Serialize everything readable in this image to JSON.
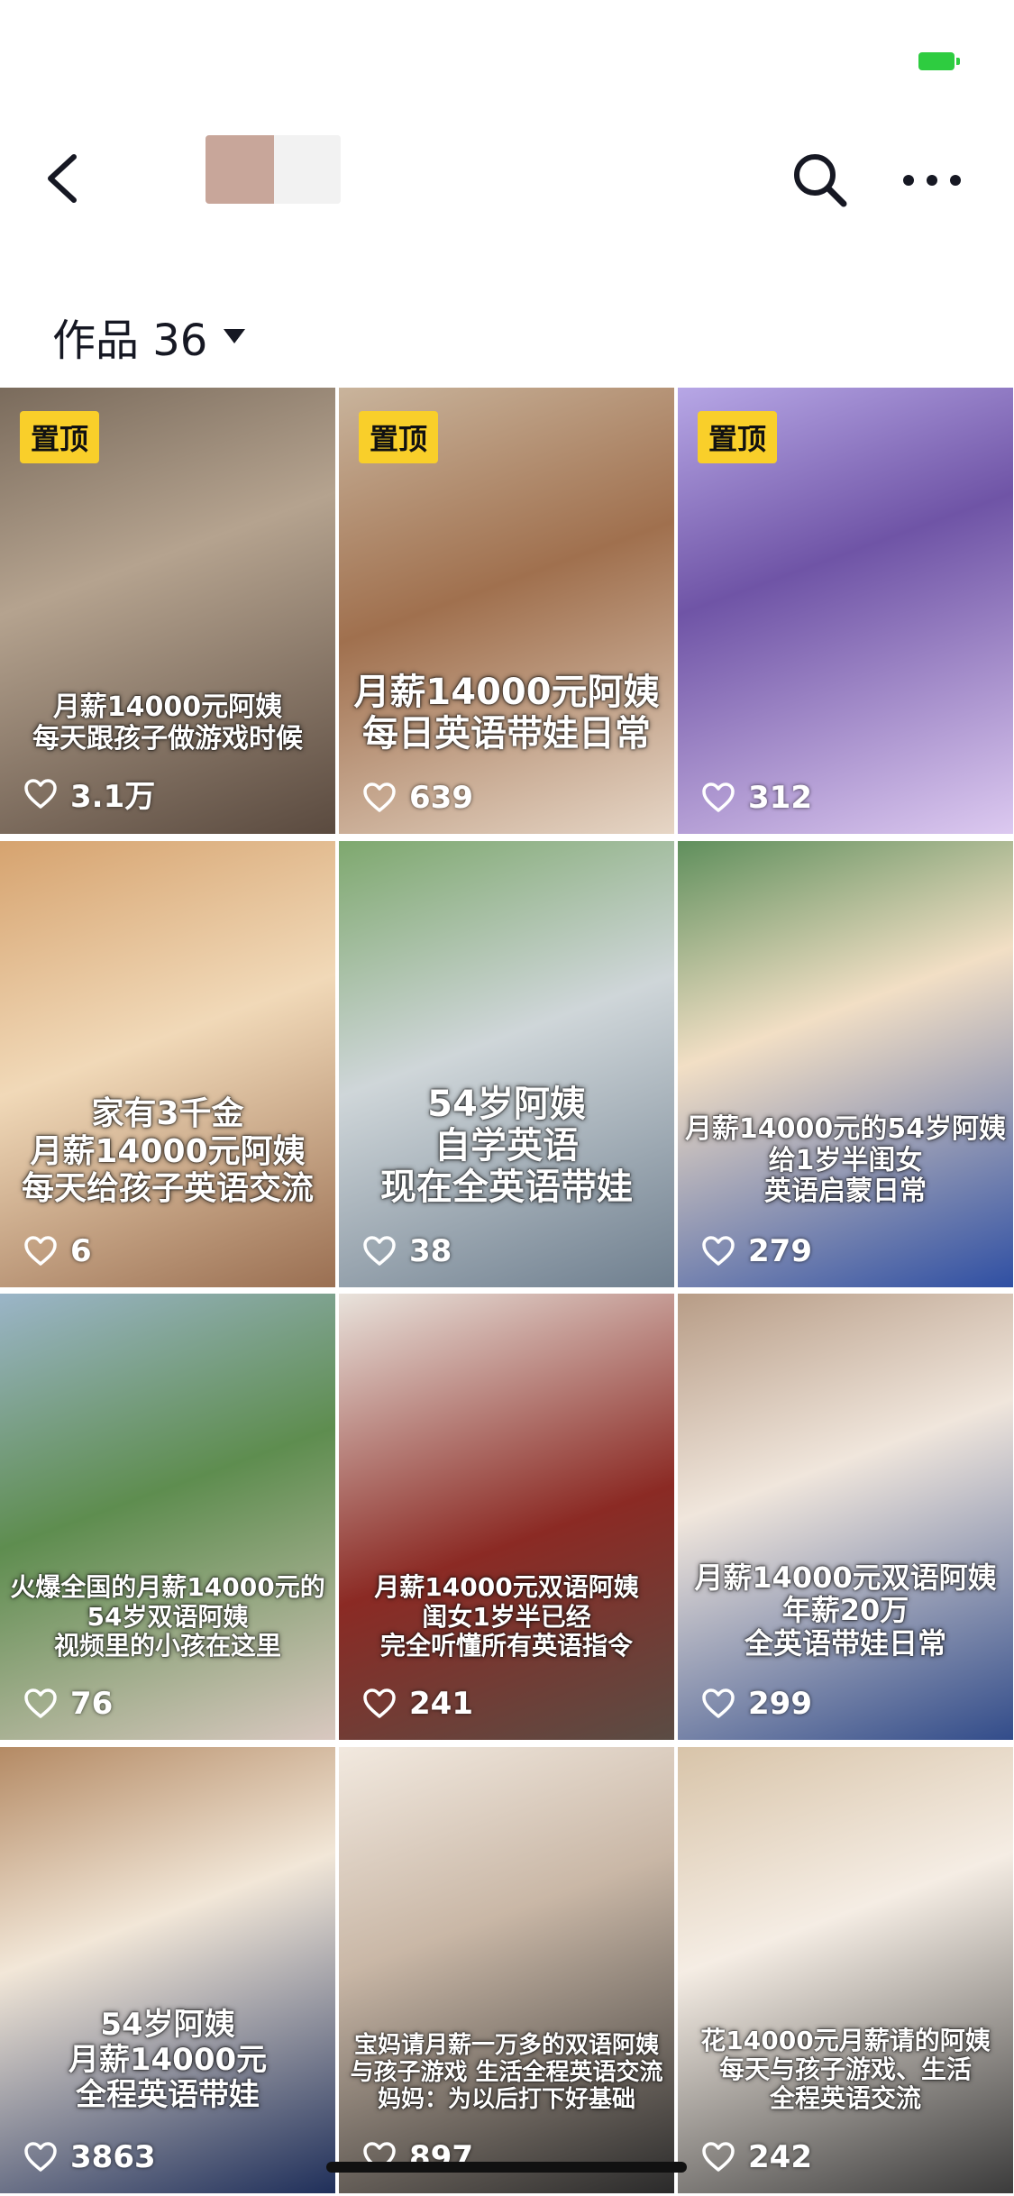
{
  "header": {
    "filter_label": "作品 36"
  },
  "tiles": [
    {
      "pinned": true,
      "pin_label": "置顶",
      "caption": [
        "月薪14000元阿姨",
        "每天跟孩子做游戏时候"
      ],
      "likes": "3.1万",
      "bg": "linear-gradient(160deg,#7a6b5c,#b5a38f 40%,#5a4a3f)",
      "cap_size": 30
    },
    {
      "pinned": true,
      "pin_label": "置顶",
      "caption": [
        "月薪14000元阿姨",
        "每日英语带娃日常"
      ],
      "likes": "639",
      "bg": "linear-gradient(160deg,#c9b49c,#a0704e 45%,#e6d6c6)",
      "cap_size": 40
    },
    {
      "pinned": true,
      "pin_label": "置顶",
      "caption": [],
      "likes": "312",
      "bg": "linear-gradient(160deg,#b7a7e6,#6f54a6 40%,#dcc9f0)",
      "cap_size": 30
    },
    {
      "pinned": false,
      "pin_label": "",
      "caption": [
        "家有3千金",
        "月薪14000元阿姨",
        "每天给孩子英语交流"
      ],
      "likes": "6",
      "bg": "linear-gradient(160deg,#d6a36f,#f1d9b8 45%,#9a6f52)",
      "cap_size": 36
    },
    {
      "pinned": false,
      "pin_label": "",
      "caption": [
        "54岁阿姨",
        "自学英语",
        "现在全英语带娃"
      ],
      "likes": "38",
      "bg": "linear-gradient(160deg,#7ea86e,#cfd6d9 45%,#6f7f8f)",
      "cap_size": 40
    },
    {
      "pinned": false,
      "pin_label": "",
      "caption": [
        "月薪14000元的54岁阿姨",
        "给1岁半闺女",
        "英语启蒙日常"
      ],
      "likes": "279",
      "bg": "linear-gradient(160deg,#5f8f5c,#f2dfc5 40%,#2f4fa3)",
      "cap_size": 30
    },
    {
      "pinned": false,
      "pin_label": "",
      "caption": [
        "火爆全国的月薪14000元的",
        "54岁双语阿姨",
        "视频里的小孩在这里"
      ],
      "likes": "76",
      "bg": "linear-gradient(160deg,#9bb5c8,#5e8d4f 45%,#d9c8c0)",
      "cap_size": 28
    },
    {
      "pinned": false,
      "pin_label": "",
      "caption": [
        "月薪14000元双语阿姨",
        "闺女1岁半已经",
        "完全听懂所有英语指令"
      ],
      "likes": "241",
      "bg": "linear-gradient(160deg,#e9e3dc,#8b2a24 55%,#5a4c44)",
      "cap_size": 28
    },
    {
      "pinned": false,
      "pin_label": "",
      "caption": [
        "月薪14000元双语阿姨",
        "年薪20万",
        "全英语带娃日常"
      ],
      "likes": "299",
      "bg": "linear-gradient(160deg,#b79c86,#f0e6dc 40%,#324c8a)",
      "cap_size": 32
    },
    {
      "pinned": false,
      "pin_label": "",
      "caption": [
        "54岁阿姨",
        "月薪14000元",
        "全程英语带娃"
      ],
      "likes": "3863",
      "bg": "linear-gradient(160deg,#b48a64,#f2e7d8 40%,#1f2f5a)",
      "cap_size": 34
    },
    {
      "pinned": false,
      "pin_label": "",
      "caption": [
        "宝妈请月薪一万多的双语阿姨",
        "与孩子游戏 生活全程英语交流",
        "妈妈：为以后打下好基础"
      ],
      "likes": "897",
      "bg": "linear-gradient(160deg,#f2e9df,#c9b7a6 40%,#2a2a2a)",
      "cap_size": 26
    },
    {
      "pinned": false,
      "pin_label": "",
      "caption": [
        "花14000元月薪请的阿姨",
        "每天与孩子游戏、生活",
        "全程英语交流"
      ],
      "likes": "242",
      "bg": "linear-gradient(160deg,#d8c4a9,#f5ede4 40%,#3b3b3b)",
      "cap_size": 28
    }
  ]
}
